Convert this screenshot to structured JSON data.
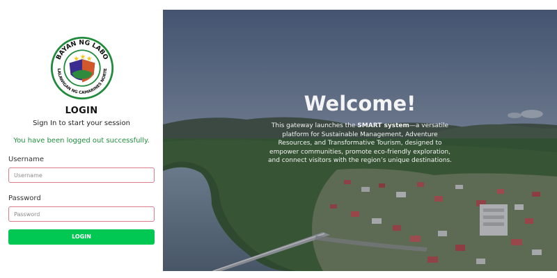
{
  "logo": {
    "top_text": "BAYAN NG LABO",
    "bottom_text": "LALAWIGAN NG CAMARINES NORTE",
    "icon": "municipal-seal-icon"
  },
  "login": {
    "title": "LOGIN",
    "subtitle": "Sign In to start your session",
    "alert": "You have been logged out successfully.",
    "username_label": "Username",
    "username_placeholder": "Username",
    "password_label": "Password",
    "password_placeholder": "Password",
    "button_label": "LOGIN"
  },
  "hero": {
    "heading": "Welcome!",
    "desc_prefix": "This gateway launches the ",
    "desc_highlight": "SMART system",
    "desc_suffix": "—a versatile platform for Sustainable Management, Adventure Resources, and Transformative Tourism, designed to empower communities, promote eco-friendly exploration, and connect visitors with the region’s unique destinations."
  },
  "colors": {
    "primary": "#00c853",
    "success_text": "#1e8e3e",
    "input_border": "#e07c88"
  }
}
